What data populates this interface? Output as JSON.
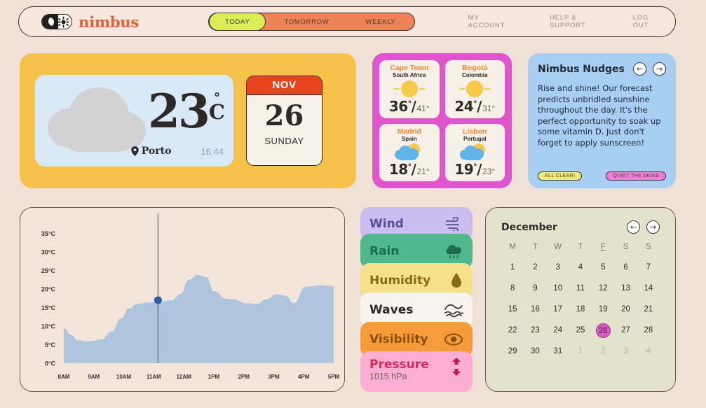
{
  "brand": {
    "name": "nimbus",
    "logo_icon": "moon-sun-toggle-icon"
  },
  "nav": {
    "segments": [
      {
        "label": "TODAY",
        "active": true
      },
      {
        "label": "TOMORROW",
        "active": false
      },
      {
        "label": "WEEKLY",
        "active": false
      }
    ],
    "menu": [
      "MY ACCOUNT",
      "HELP & SUPPORT",
      "LOG OUT"
    ]
  },
  "current": {
    "temperature": "23",
    "degree_symbol": "°",
    "unit": "C",
    "location": "Porto",
    "time": "16:44",
    "condition_icon": "cloud-icon",
    "location_icon": "map-pin-icon"
  },
  "date_card": {
    "month": "NOV",
    "day": "26",
    "weekday": "SUNDAY"
  },
  "cities": [
    {
      "name": "Cape Town",
      "country": "South Africa",
      "high": "36",
      "low": "41",
      "icon": "sun-icon"
    },
    {
      "name": "Bogotà",
      "country": "Colombia",
      "high": "24",
      "low": "31",
      "icon": "sun-icon"
    },
    {
      "name": "Madrid",
      "country": "Spain",
      "high": "18",
      "low": "21",
      "icon": "sun-cloud-icon"
    },
    {
      "name": "Lisbon",
      "country": "Portugal",
      "high": "19",
      "low": "23",
      "icon": "sun-cloud-icon"
    }
  ],
  "nudges": {
    "title": "Nimbus Nudges",
    "prev_icon": "arrow-left-icon",
    "next_icon": "arrow-right-icon",
    "body": "Rise and shine! Our forecast predicts unbridled sunshine throughout the day. It's the perfect opportunity to soak up some vitamin D. Just don't forget to apply sunscreen!",
    "tags": [
      {
        "label": "ALL CLEAR!",
        "color": "#eeea76"
      },
      {
        "label": "QUIET THE SKIES",
        "color": "#ef7ed9"
      }
    ]
  },
  "metrics": [
    {
      "label": "Wind",
      "icon": "wind-icon",
      "bg": "#cbbdf0",
      "fg": "#5a4f96",
      "value": ""
    },
    {
      "label": "Rain",
      "icon": "rain-cloud-icon",
      "bg": "#4fb88d",
      "fg": "#1e6b4e",
      "value": ""
    },
    {
      "label": "Humidity",
      "icon": "droplet-icon",
      "bg": "#f7e08a",
      "fg": "#8a6b13",
      "value": ""
    },
    {
      "label": "Waves",
      "icon": "waves-icon",
      "bg": "#f7f4ee",
      "fg": "#2d2a27",
      "value": ""
    },
    {
      "label": "Visibility",
      "icon": "eye-icon",
      "bg": "#f59b39",
      "fg": "#8a4f0d",
      "value": ""
    },
    {
      "label": "Pressure",
      "icon": "pressure-icon",
      "bg": "#fbaed2",
      "fg": "#d6285c",
      "value": "1015 hPa"
    }
  ],
  "calendar": {
    "title": "December",
    "prev_icon": "arrow-left-icon",
    "next_icon": "arrow-right-icon",
    "dow": [
      "M",
      "T",
      "W",
      "T",
      "F",
      "S",
      "S"
    ],
    "dow_underline_index": 4,
    "selected_day": "26",
    "weeks": [
      [
        {
          "d": "1"
        },
        {
          "d": "2"
        },
        {
          "d": "3"
        },
        {
          "d": "4"
        },
        {
          "d": "5"
        },
        {
          "d": "6"
        },
        {
          "d": "7"
        }
      ],
      [
        {
          "d": "8"
        },
        {
          "d": "9"
        },
        {
          "d": "10"
        },
        {
          "d": "11"
        },
        {
          "d": "12"
        },
        {
          "d": "13"
        },
        {
          "d": "14"
        }
      ],
      [
        {
          "d": "15"
        },
        {
          "d": "16"
        },
        {
          "d": "17"
        },
        {
          "d": "18"
        },
        {
          "d": "19"
        },
        {
          "d": "20"
        },
        {
          "d": "21"
        }
      ],
      [
        {
          "d": "22"
        },
        {
          "d": "23"
        },
        {
          "d": "24"
        },
        {
          "d": "25"
        },
        {
          "d": "26",
          "sel": true
        },
        {
          "d": "27"
        },
        {
          "d": "28"
        }
      ],
      [
        {
          "d": "29"
        },
        {
          "d": "30"
        },
        {
          "d": "31"
        },
        {
          "d": "1",
          "muted": true
        },
        {
          "d": "2",
          "muted": true
        },
        {
          "d": "3",
          "muted": true
        },
        {
          "d": "4",
          "muted": true
        }
      ]
    ]
  },
  "chart_data": {
    "type": "area",
    "title": "",
    "xlabel": "",
    "ylabel": "",
    "ylim": [
      0,
      37
    ],
    "yticks": [
      "0°C",
      "5°C",
      "10°C",
      "15°C",
      "20°C",
      "25°C",
      "30°C",
      "35°C"
    ],
    "ytick_values": [
      0,
      5,
      10,
      15,
      20,
      25,
      30,
      35
    ],
    "categories": [
      "8AM",
      "9AM",
      "10AM",
      "11AM",
      "12AM",
      "1PM",
      "2PM",
      "3PM",
      "4PM",
      "5PM"
    ],
    "values": [
      9.5,
      6.0,
      7.5,
      15.5,
      16.5,
      24.0,
      18.0,
      16.5,
      18.5,
      17.0
    ],
    "dense_x": [
      0,
      0.25,
      0.5,
      0.75,
      1.0,
      1.3,
      1.7,
      2.0,
      2.3,
      2.6,
      3.0,
      3.4,
      3.8,
      4.1,
      4.4,
      4.7,
      5.0,
      5.3,
      5.7,
      6.0,
      6.4,
      6.8,
      7.1,
      7.5,
      7.8,
      8.1,
      8.5,
      9.0,
      9.5
    ],
    "dense_y": [
      9.5,
      7.6,
      6.2,
      5.9,
      6.0,
      6.4,
      8.6,
      12.0,
      14.8,
      16.0,
      16.4,
      16.6,
      17.0,
      18.6,
      22.5,
      23.8,
      23.3,
      19.4,
      17.4,
      17.2,
      16.2,
      16.0,
      17.2,
      18.6,
      18.2,
      16.2,
      20.6,
      21.0,
      20.8
    ],
    "marker": {
      "x_label": "11AM",
      "value": 17.0,
      "color": "#2b5ea8"
    },
    "area_color": "#afc5de",
    "grid": false,
    "legend": null
  }
}
